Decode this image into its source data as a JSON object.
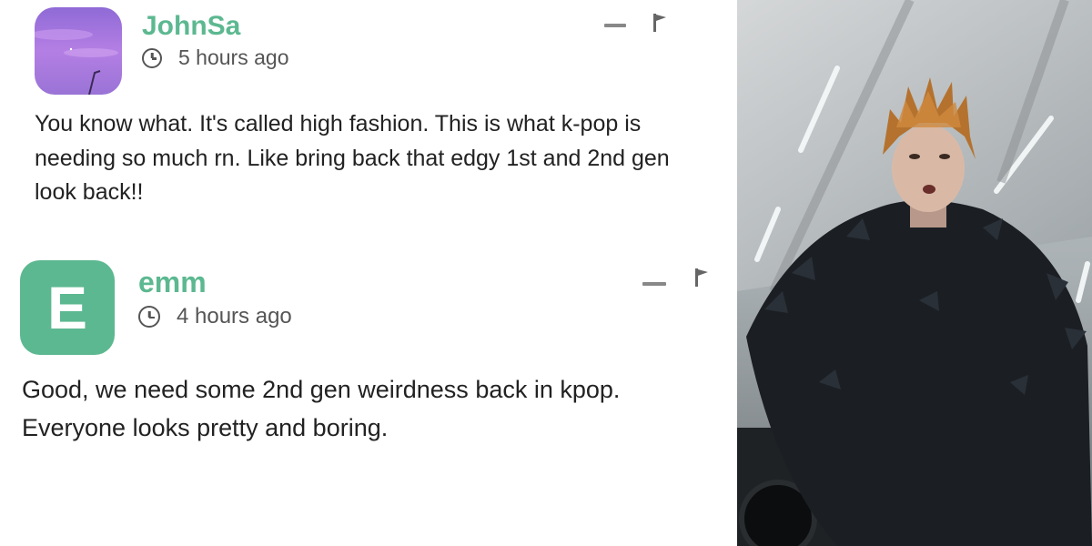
{
  "comments": [
    {
      "username": "JohnSa",
      "time": "5 hours ago",
      "avatar": {
        "type": "photo",
        "description_icon": "sunset-sky-avatar"
      },
      "text": "You know what. It's called high fashion. This is what k-pop is needing so much rn. Like bring back that edgy 1st and 2nd gen look back!!"
    },
    {
      "username": "emm",
      "time": "4 hours ago",
      "avatar": {
        "type": "letter",
        "letter": "E",
        "color": "#5cb890"
      },
      "text": "Good, we need some 2nd gen weirdness back in kpop. Everyone looks pretty and boring."
    }
  ],
  "colors": {
    "username": "#5cb890",
    "meta_text": "#555555",
    "body_text": "#222222",
    "icon_gray": "#888888"
  },
  "icons": [
    "clock-icon",
    "collapse-icon",
    "flag-icon"
  ]
}
